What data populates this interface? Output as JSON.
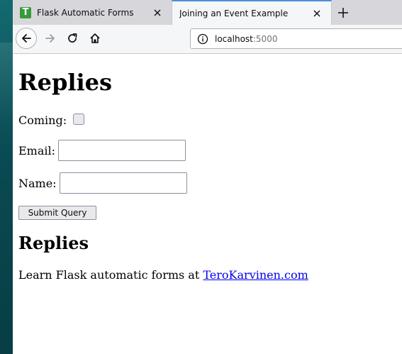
{
  "browser": {
    "tabs": [
      {
        "title": "Flask Automatic Forms",
        "favicon_letter": "T",
        "active": false
      },
      {
        "title": "Joining an Event Example",
        "active": true
      }
    ],
    "url": {
      "host": "localhost",
      "port": ":5000"
    }
  },
  "page": {
    "heading": "Replies",
    "form": {
      "coming_label": "Coming:",
      "coming_checked": false,
      "email_label": "Email:",
      "email_value": "",
      "name_label": "Name:",
      "name_value": "",
      "submit_label": "Submit Query"
    },
    "section_heading": "Replies",
    "footer": {
      "text": "Learn Flask automatic forms at",
      "link_text": "TeroKarvinen.com"
    }
  },
  "colors": {
    "tab_accent": "#4a90d9",
    "favicon": "#3a9a3a",
    "link": "#0000ee",
    "tabbar": "#d7d7db",
    "toolbar": "#f5f6f7"
  },
  "icons": [
    "close-icon",
    "plus-icon",
    "back-arrow-icon",
    "forward-arrow-icon",
    "reload-icon",
    "home-icon",
    "info-icon"
  ]
}
